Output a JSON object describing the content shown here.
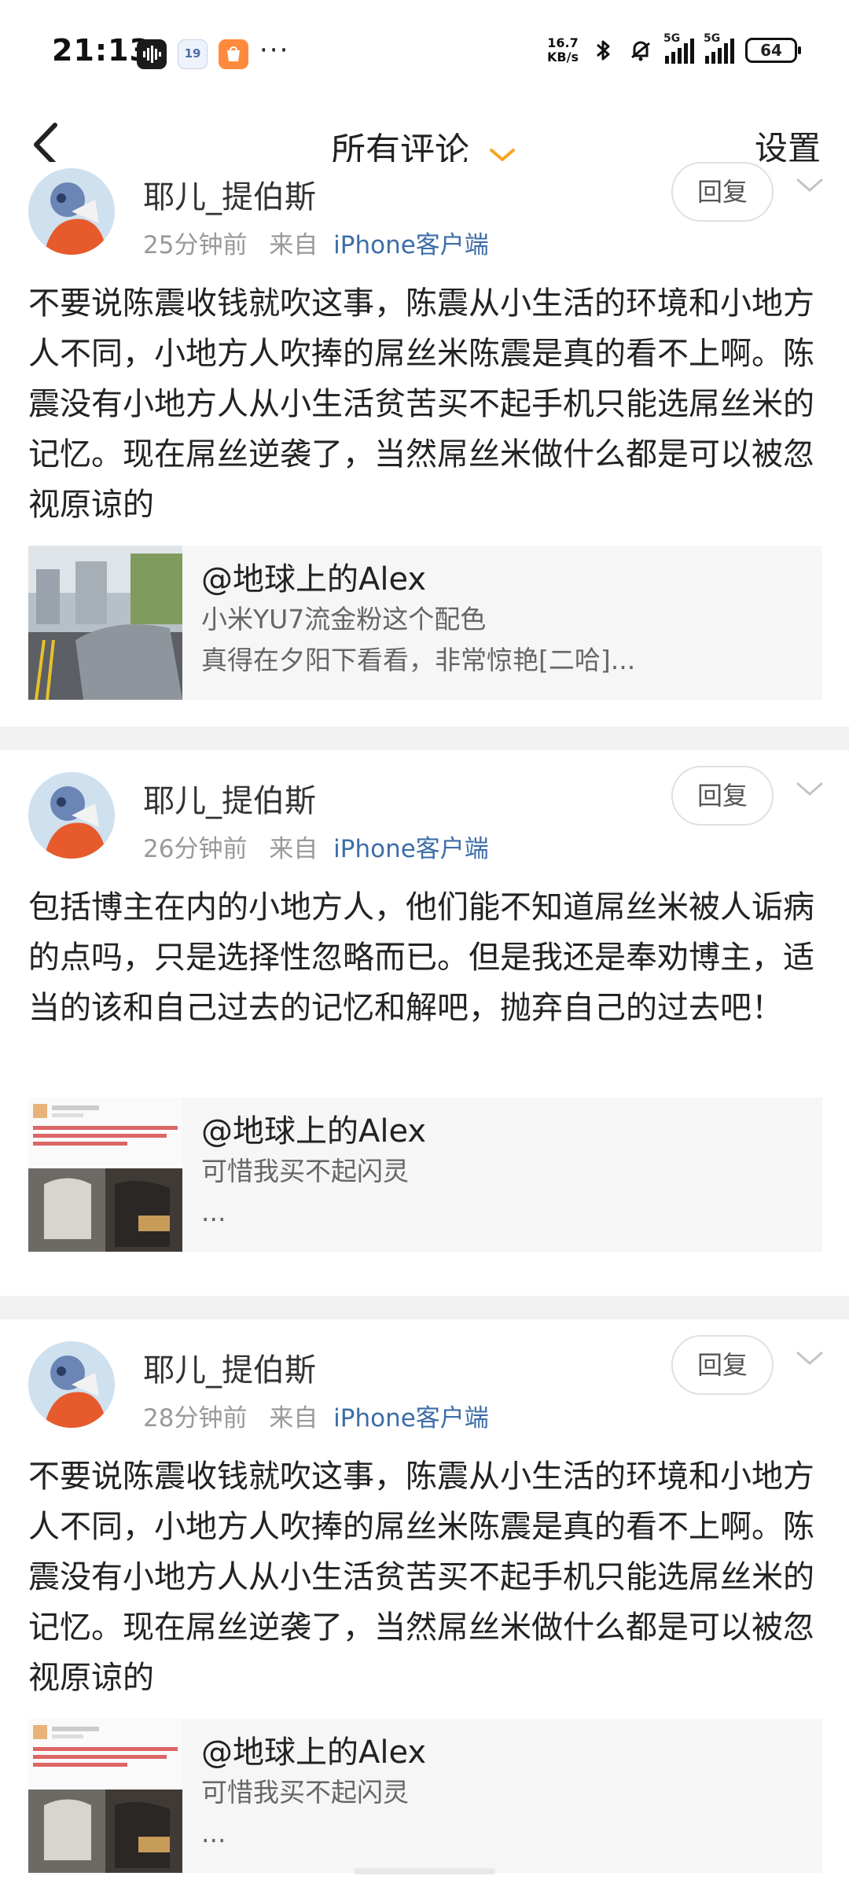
{
  "status_bar": {
    "time": "21:13",
    "app_badge_2": "19",
    "more": "···",
    "speed_value": "16.7",
    "speed_unit": "KB/s",
    "net1": "5G",
    "net2": "5G",
    "battery": "64"
  },
  "nav": {
    "title": "所有评论",
    "settings": "设置"
  },
  "comments": [
    {
      "user": "耶儿_提伯斯",
      "time": "25分钟前",
      "from_label": "来自",
      "client": "iPhone客户端",
      "reply": "回复",
      "text": "不要说陈震收钱就吹这事，陈震从小生活的环境和小地方人不同，小地方人吹捧的屌丝米陈震是真的看不上啊。陈震没有小地方人从小生活贫苦买不起手机只能选屌丝米的记忆。现在屌丝逆袭了，当然屌丝米做什么都是可以被忽视原谅的",
      "card": {
        "user": "@地球上的Alex",
        "line1": "小米YU7流金粉这个配色",
        "line2": "真得在夕阳下看看，非常惊艳[二哈]..."
      }
    },
    {
      "user": "耶儿_提伯斯",
      "time": "26分钟前",
      "from_label": "来自",
      "client": "iPhone客户端",
      "reply": "回复",
      "text": "包括博主在内的小地方人，他们能不知道屌丝米被人诟病的点吗，只是选择性忽略而已。但是我还是奉劝博主，适当的该和自己过去的记忆和解吧，抛弃自己的过去吧！",
      "card": {
        "user": "@地球上的Alex",
        "line1": "可惜我买不起闪灵",
        "line2": "..."
      }
    },
    {
      "user": "耶儿_提伯斯",
      "time": "28分钟前",
      "from_label": "来自",
      "client": "iPhone客户端",
      "reply": "回复",
      "text": "不要说陈震收钱就吹这事，陈震从小生活的环境和小地方人不同，小地方人吹捧的屌丝米陈震是真的看不上啊。陈震没有小地方人从小生活贫苦买不起手机只能选屌丝米的记忆。现在屌丝逆袭了，当然屌丝米做什么都是可以被忽视原谅的",
      "card": {
        "user": "@地球上的Alex",
        "line1": "可惜我买不起闪灵",
        "line2": "..."
      }
    }
  ],
  "colors": {
    "accent_orange": "#f5a623",
    "link_blue": "#3d6da8",
    "divider": "#f1f1f1"
  }
}
